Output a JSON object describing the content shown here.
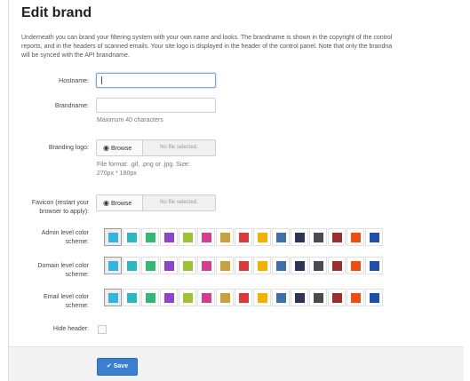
{
  "page": {
    "title": "Edit brand"
  },
  "description": [
    "Underneath you can brand your filtering system with your own name and looks. The brandname is shown in the copyright of the control",
    "reports, and in the headers of scanned emails. Your site logo is displayed in the header of the control panel. Note that only the brandna",
    "will be synced with the API brandname."
  ],
  "form": {
    "hostname": {
      "label": "Hostname:",
      "value": ""
    },
    "brandname": {
      "label": "Brandname:",
      "value": "",
      "help": "Maximum 40 characters"
    },
    "logo": {
      "label": "Branding logo:",
      "browse_label": "Browse",
      "file_status": "No file selected.",
      "help_line1": "File format: .gif, .png or .jpg. Size:",
      "help_line2": "270px * 180px"
    },
    "favicon": {
      "label_line1": "Favicon (restart your",
      "label_line2": "browser to apply):",
      "browse_label": "Browse",
      "file_status": "No file selected."
    },
    "admin_scheme": {
      "label_line1": "Admin level color",
      "label_line2": "scheme:"
    },
    "domain_scheme": {
      "label_line1": "Domain level color",
      "label_line2": "scheme:"
    },
    "email_scheme": {
      "label_line1": "Email level color",
      "label_line2": "scheme:"
    },
    "hide_header": {
      "label": "Hide header:",
      "checked": false
    },
    "save_label": "Save"
  },
  "color_swatches": [
    "#35b5dc",
    "#2bb8c1",
    "#39b676",
    "#8e46c8",
    "#9fc238",
    "#d23f8a",
    "#c8a040",
    "#d93b3b",
    "#f4b200",
    "#3f6fa6",
    "#2e3458",
    "#4a4a52",
    "#9a2f2f",
    "#ef4d12",
    "#1f4fa6"
  ],
  "selected_swatch_index": 0
}
